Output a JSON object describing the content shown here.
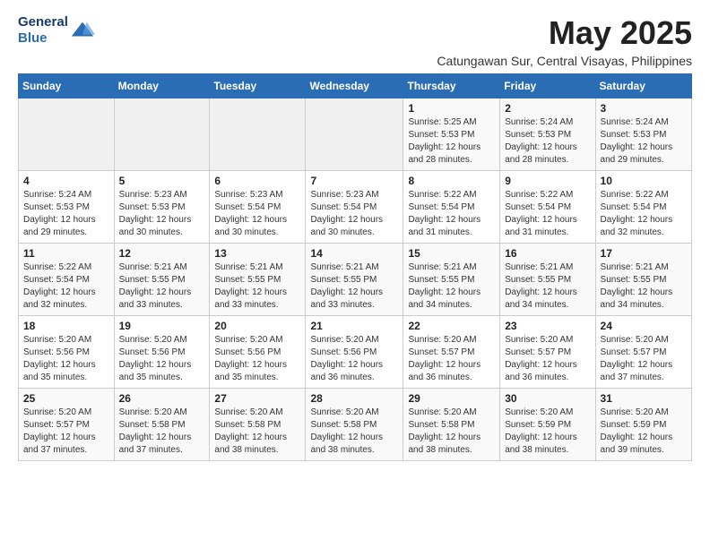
{
  "header": {
    "logo_line1": "General",
    "logo_line2": "Blue",
    "month": "May 2025",
    "location": "Catungawan Sur, Central Visayas, Philippines"
  },
  "weekdays": [
    "Sunday",
    "Monday",
    "Tuesday",
    "Wednesday",
    "Thursday",
    "Friday",
    "Saturday"
  ],
  "weeks": [
    [
      {
        "day": "",
        "info": ""
      },
      {
        "day": "",
        "info": ""
      },
      {
        "day": "",
        "info": ""
      },
      {
        "day": "",
        "info": ""
      },
      {
        "day": "1",
        "info": "Sunrise: 5:25 AM\nSunset: 5:53 PM\nDaylight: 12 hours\nand 28 minutes."
      },
      {
        "day": "2",
        "info": "Sunrise: 5:24 AM\nSunset: 5:53 PM\nDaylight: 12 hours\nand 28 minutes."
      },
      {
        "day": "3",
        "info": "Sunrise: 5:24 AM\nSunset: 5:53 PM\nDaylight: 12 hours\nand 29 minutes."
      }
    ],
    [
      {
        "day": "4",
        "info": "Sunrise: 5:24 AM\nSunset: 5:53 PM\nDaylight: 12 hours\nand 29 minutes."
      },
      {
        "day": "5",
        "info": "Sunrise: 5:23 AM\nSunset: 5:53 PM\nDaylight: 12 hours\nand 30 minutes."
      },
      {
        "day": "6",
        "info": "Sunrise: 5:23 AM\nSunset: 5:54 PM\nDaylight: 12 hours\nand 30 minutes."
      },
      {
        "day": "7",
        "info": "Sunrise: 5:23 AM\nSunset: 5:54 PM\nDaylight: 12 hours\nand 30 minutes."
      },
      {
        "day": "8",
        "info": "Sunrise: 5:22 AM\nSunset: 5:54 PM\nDaylight: 12 hours\nand 31 minutes."
      },
      {
        "day": "9",
        "info": "Sunrise: 5:22 AM\nSunset: 5:54 PM\nDaylight: 12 hours\nand 31 minutes."
      },
      {
        "day": "10",
        "info": "Sunrise: 5:22 AM\nSunset: 5:54 PM\nDaylight: 12 hours\nand 32 minutes."
      }
    ],
    [
      {
        "day": "11",
        "info": "Sunrise: 5:22 AM\nSunset: 5:54 PM\nDaylight: 12 hours\nand 32 minutes."
      },
      {
        "day": "12",
        "info": "Sunrise: 5:21 AM\nSunset: 5:55 PM\nDaylight: 12 hours\nand 33 minutes."
      },
      {
        "day": "13",
        "info": "Sunrise: 5:21 AM\nSunset: 5:55 PM\nDaylight: 12 hours\nand 33 minutes."
      },
      {
        "day": "14",
        "info": "Sunrise: 5:21 AM\nSunset: 5:55 PM\nDaylight: 12 hours\nand 33 minutes."
      },
      {
        "day": "15",
        "info": "Sunrise: 5:21 AM\nSunset: 5:55 PM\nDaylight: 12 hours\nand 34 minutes."
      },
      {
        "day": "16",
        "info": "Sunrise: 5:21 AM\nSunset: 5:55 PM\nDaylight: 12 hours\nand 34 minutes."
      },
      {
        "day": "17",
        "info": "Sunrise: 5:21 AM\nSunset: 5:55 PM\nDaylight: 12 hours\nand 34 minutes."
      }
    ],
    [
      {
        "day": "18",
        "info": "Sunrise: 5:20 AM\nSunset: 5:56 PM\nDaylight: 12 hours\nand 35 minutes."
      },
      {
        "day": "19",
        "info": "Sunrise: 5:20 AM\nSunset: 5:56 PM\nDaylight: 12 hours\nand 35 minutes."
      },
      {
        "day": "20",
        "info": "Sunrise: 5:20 AM\nSunset: 5:56 PM\nDaylight: 12 hours\nand 35 minutes."
      },
      {
        "day": "21",
        "info": "Sunrise: 5:20 AM\nSunset: 5:56 PM\nDaylight: 12 hours\nand 36 minutes."
      },
      {
        "day": "22",
        "info": "Sunrise: 5:20 AM\nSunset: 5:57 PM\nDaylight: 12 hours\nand 36 minutes."
      },
      {
        "day": "23",
        "info": "Sunrise: 5:20 AM\nSunset: 5:57 PM\nDaylight: 12 hours\nand 36 minutes."
      },
      {
        "day": "24",
        "info": "Sunrise: 5:20 AM\nSunset: 5:57 PM\nDaylight: 12 hours\nand 37 minutes."
      }
    ],
    [
      {
        "day": "25",
        "info": "Sunrise: 5:20 AM\nSunset: 5:57 PM\nDaylight: 12 hours\nand 37 minutes."
      },
      {
        "day": "26",
        "info": "Sunrise: 5:20 AM\nSunset: 5:58 PM\nDaylight: 12 hours\nand 37 minutes."
      },
      {
        "day": "27",
        "info": "Sunrise: 5:20 AM\nSunset: 5:58 PM\nDaylight: 12 hours\nand 38 minutes."
      },
      {
        "day": "28",
        "info": "Sunrise: 5:20 AM\nSunset: 5:58 PM\nDaylight: 12 hours\nand 38 minutes."
      },
      {
        "day": "29",
        "info": "Sunrise: 5:20 AM\nSunset: 5:58 PM\nDaylight: 12 hours\nand 38 minutes."
      },
      {
        "day": "30",
        "info": "Sunrise: 5:20 AM\nSunset: 5:59 PM\nDaylight: 12 hours\nand 38 minutes."
      },
      {
        "day": "31",
        "info": "Sunrise: 5:20 AM\nSunset: 5:59 PM\nDaylight: 12 hours\nand 39 minutes."
      }
    ]
  ]
}
